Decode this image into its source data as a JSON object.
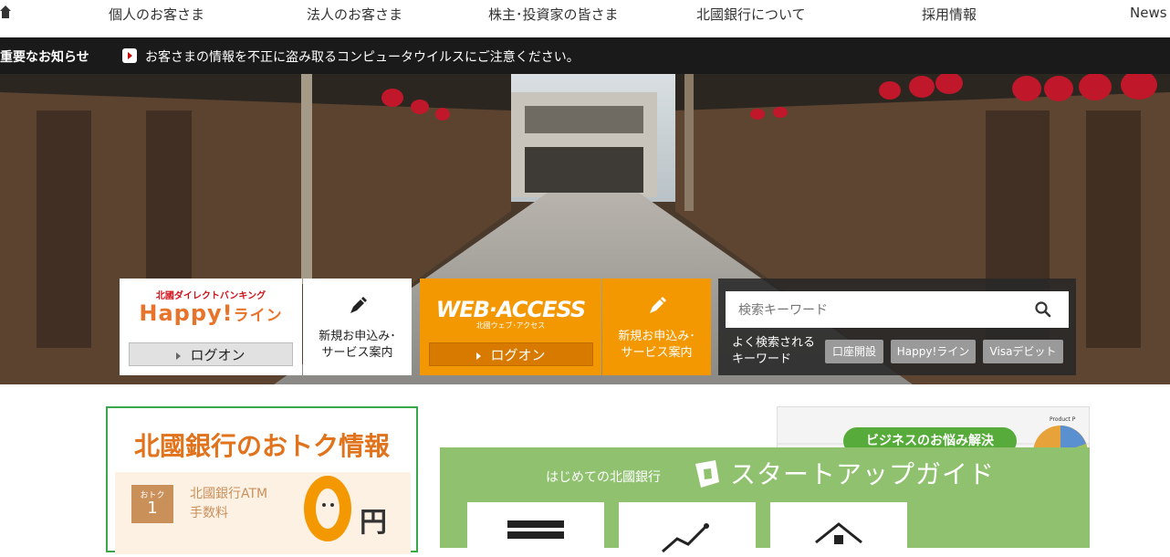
{
  "top_nav": {
    "home_icon": "home-icon",
    "items": [
      "個人のお客さま",
      "法人のお客さま",
      "株主･投資家の皆さま",
      "北國銀行について",
      "採用情報",
      "News"
    ]
  },
  "notice": {
    "label": "重要なお知らせ",
    "message": "お客さまの情報を不正に盗み取るコンピュータウイルスにご注意ください。"
  },
  "happy": {
    "caption": "北國ダイレクトバンキング",
    "logo_main": "Happy!",
    "logo_sub": "ライン",
    "login": "ログオン",
    "new_text": "新規お申込み･\nサービス案内"
  },
  "web_access": {
    "logo": "WEB·ACCESS",
    "logo_sub": "北國ウェブ･アクセス",
    "login": "ログオン",
    "new_text": "新規お申込み･\nサービス案内"
  },
  "search": {
    "placeholder": "検索キーワード",
    "keywords_label": "よく検索される\nキーワード",
    "keywords": [
      "口座開設",
      "Happy!ライン",
      "Visaデビット"
    ]
  },
  "otoku": {
    "title": "北國銀行のおトク情報",
    "badge_top": "おトク",
    "badge_num": "1",
    "feature": "北國銀行ATM\n手数料",
    "yen": "円"
  },
  "promo": {
    "pill": "ビジネスのお悩み解決",
    "tag": "Product P"
  },
  "startup": {
    "pre": "はじめての北國銀行",
    "main": "スタートアップガイド"
  },
  "colors": {
    "accent_orange": "#f39800",
    "brand_green": "#3aa74a",
    "notice_bg": "#1a1a1a"
  }
}
